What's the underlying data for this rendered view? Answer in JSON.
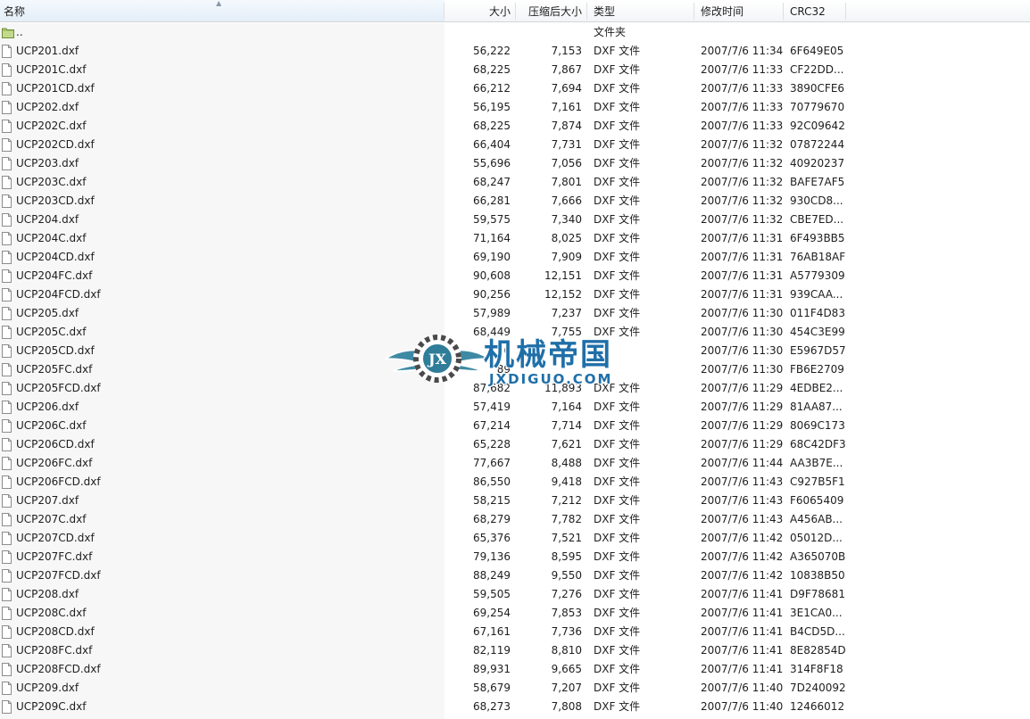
{
  "columns": {
    "name": "名称",
    "size": "大小",
    "compressed": "压缩后大小",
    "type": "类型",
    "modified": "修改时间",
    "crc": "CRC32"
  },
  "parent_row": {
    "name": "..",
    "type": "文件夹"
  },
  "files": [
    {
      "name": "UCP201.dxf",
      "size": "56,222",
      "compressed": "7,153",
      "type": "DXF 文件",
      "modified": "2007/7/6 11:34",
      "crc": "6F649E05"
    },
    {
      "name": "UCP201C.dxf",
      "size": "68,225",
      "compressed": "7,867",
      "type": "DXF 文件",
      "modified": "2007/7/6 11:33",
      "crc": "CF22DD..."
    },
    {
      "name": "UCP201CD.dxf",
      "size": "66,212",
      "compressed": "7,694",
      "type": "DXF 文件",
      "modified": "2007/7/6 11:33",
      "crc": "3890CFE6"
    },
    {
      "name": "UCP202.dxf",
      "size": "56,195",
      "compressed": "7,161",
      "type": "DXF 文件",
      "modified": "2007/7/6 11:33",
      "crc": "70779670"
    },
    {
      "name": "UCP202C.dxf",
      "size": "68,225",
      "compressed": "7,874",
      "type": "DXF 文件",
      "modified": "2007/7/6 11:33",
      "crc": "92C09642"
    },
    {
      "name": "UCP202CD.dxf",
      "size": "66,404",
      "compressed": "7,731",
      "type": "DXF 文件",
      "modified": "2007/7/6 11:32",
      "crc": "07872244"
    },
    {
      "name": "UCP203.dxf",
      "size": "55,696",
      "compressed": "7,056",
      "type": "DXF 文件",
      "modified": "2007/7/6 11:32",
      "crc": "40920237"
    },
    {
      "name": "UCP203C.dxf",
      "size": "68,247",
      "compressed": "7,801",
      "type": "DXF 文件",
      "modified": "2007/7/6 11:32",
      "crc": "BAFE7AF5"
    },
    {
      "name": "UCP203CD.dxf",
      "size": "66,281",
      "compressed": "7,666",
      "type": "DXF 文件",
      "modified": "2007/7/6 11:32",
      "crc": "930CD8..."
    },
    {
      "name": "UCP204.dxf",
      "size": "59,575",
      "compressed": "7,340",
      "type": "DXF 文件",
      "modified": "2007/7/6 11:32",
      "crc": "CBE7ED..."
    },
    {
      "name": "UCP204C.dxf",
      "size": "71,164",
      "compressed": "8,025",
      "type": "DXF 文件",
      "modified": "2007/7/6 11:31",
      "crc": "6F493BB5"
    },
    {
      "name": "UCP204CD.dxf",
      "size": "69,190",
      "compressed": "7,909",
      "type": "DXF 文件",
      "modified": "2007/7/6 11:31",
      "crc": "76AB18AF"
    },
    {
      "name": "UCP204FC.dxf",
      "size": "90,608",
      "compressed": "12,151",
      "type": "DXF 文件",
      "modified": "2007/7/6 11:31",
      "crc": "A5779309"
    },
    {
      "name": "UCP204FCD.dxf",
      "size": "90,256",
      "compressed": "12,152",
      "type": "DXF 文件",
      "modified": "2007/7/6 11:31",
      "crc": "939CAA..."
    },
    {
      "name": "UCP205.dxf",
      "size": "57,989",
      "compressed": "7,237",
      "type": "DXF 文件",
      "modified": "2007/7/6 11:30",
      "crc": "011F4D83"
    },
    {
      "name": "UCP205C.dxf",
      "size": "68,449",
      "compressed": "7,755",
      "type": "DXF 文件",
      "modified": "2007/7/6 11:30",
      "crc": "454C3E99"
    },
    {
      "name": "UCP205CD.dxf",
      "size": "6",
      "compressed": "",
      "type": "",
      "modified": "2007/7/6 11:30",
      "crc": "E5967D57"
    },
    {
      "name": "UCP205FC.dxf",
      "size": "89",
      "compressed": "",
      "type": "",
      "modified": "2007/7/6 11:30",
      "crc": "FB6E2709"
    },
    {
      "name": "UCP205FCD.dxf",
      "size": "87,682",
      "compressed": "11,893",
      "type": "DXF 文件",
      "modified": "2007/7/6 11:29",
      "crc": "4EDBE2..."
    },
    {
      "name": "UCP206.dxf",
      "size": "57,419",
      "compressed": "7,164",
      "type": "DXF 文件",
      "modified": "2007/7/6 11:29",
      "crc": "81AA87..."
    },
    {
      "name": "UCP206C.dxf",
      "size": "67,214",
      "compressed": "7,714",
      "type": "DXF 文件",
      "modified": "2007/7/6 11:29",
      "crc": "8069C173"
    },
    {
      "name": "UCP206CD.dxf",
      "size": "65,228",
      "compressed": "7,621",
      "type": "DXF 文件",
      "modified": "2007/7/6 11:29",
      "crc": "68C42DF3"
    },
    {
      "name": "UCP206FC.dxf",
      "size": "77,667",
      "compressed": "8,488",
      "type": "DXF 文件",
      "modified": "2007/7/6 11:44",
      "crc": "AA3B7E..."
    },
    {
      "name": "UCP206FCD.dxf",
      "size": "86,550",
      "compressed": "9,418",
      "type": "DXF 文件",
      "modified": "2007/7/6 11:43",
      "crc": "C927B5F1"
    },
    {
      "name": "UCP207.dxf",
      "size": "58,215",
      "compressed": "7,212",
      "type": "DXF 文件",
      "modified": "2007/7/6 11:43",
      "crc": "F6065409"
    },
    {
      "name": "UCP207C.dxf",
      "size": "68,279",
      "compressed": "7,782",
      "type": "DXF 文件",
      "modified": "2007/7/6 11:43",
      "crc": "A456AB..."
    },
    {
      "name": "UCP207CD.dxf",
      "size": "65,376",
      "compressed": "7,521",
      "type": "DXF 文件",
      "modified": "2007/7/6 11:42",
      "crc": "05012D..."
    },
    {
      "name": "UCP207FC.dxf",
      "size": "79,136",
      "compressed": "8,595",
      "type": "DXF 文件",
      "modified": "2007/7/6 11:42",
      "crc": "A365070B"
    },
    {
      "name": "UCP207FCD.dxf",
      "size": "88,249",
      "compressed": "9,550",
      "type": "DXF 文件",
      "modified": "2007/7/6 11:42",
      "crc": "10838B50"
    },
    {
      "name": "UCP208.dxf",
      "size": "59,505",
      "compressed": "7,276",
      "type": "DXF 文件",
      "modified": "2007/7/6 11:41",
      "crc": "D9F78681"
    },
    {
      "name": "UCP208C.dxf",
      "size": "69,254",
      "compressed": "7,853",
      "type": "DXF 文件",
      "modified": "2007/7/6 11:41",
      "crc": "3E1CA0..."
    },
    {
      "name": "UCP208CD.dxf",
      "size": "67,161",
      "compressed": "7,736",
      "type": "DXF 文件",
      "modified": "2007/7/6 11:41",
      "crc": "B4CD5D..."
    },
    {
      "name": "UCP208FC.dxf",
      "size": "82,119",
      "compressed": "8,810",
      "type": "DXF 文件",
      "modified": "2007/7/6 11:41",
      "crc": "8E82854D"
    },
    {
      "name": "UCP208FCD.dxf",
      "size": "89,931",
      "compressed": "9,665",
      "type": "DXF 文件",
      "modified": "2007/7/6 11:41",
      "crc": "314F8F18"
    },
    {
      "name": "UCP209.dxf",
      "size": "58,679",
      "compressed": "7,207",
      "type": "DXF 文件",
      "modified": "2007/7/6 11:40",
      "crc": "7D240092"
    },
    {
      "name": "UCP209C.dxf",
      "size": "68,273",
      "compressed": "7,808",
      "type": "DXF 文件",
      "modified": "2007/7/6 11:40",
      "crc": "12466012"
    }
  ],
  "watermark": {
    "title": "机械帝国",
    "subtitle": "JXDIGUO.COM",
    "badge": "JX"
  },
  "colors": {
    "watermark": "#1f6fa8",
    "folder": "#8fb35a"
  }
}
